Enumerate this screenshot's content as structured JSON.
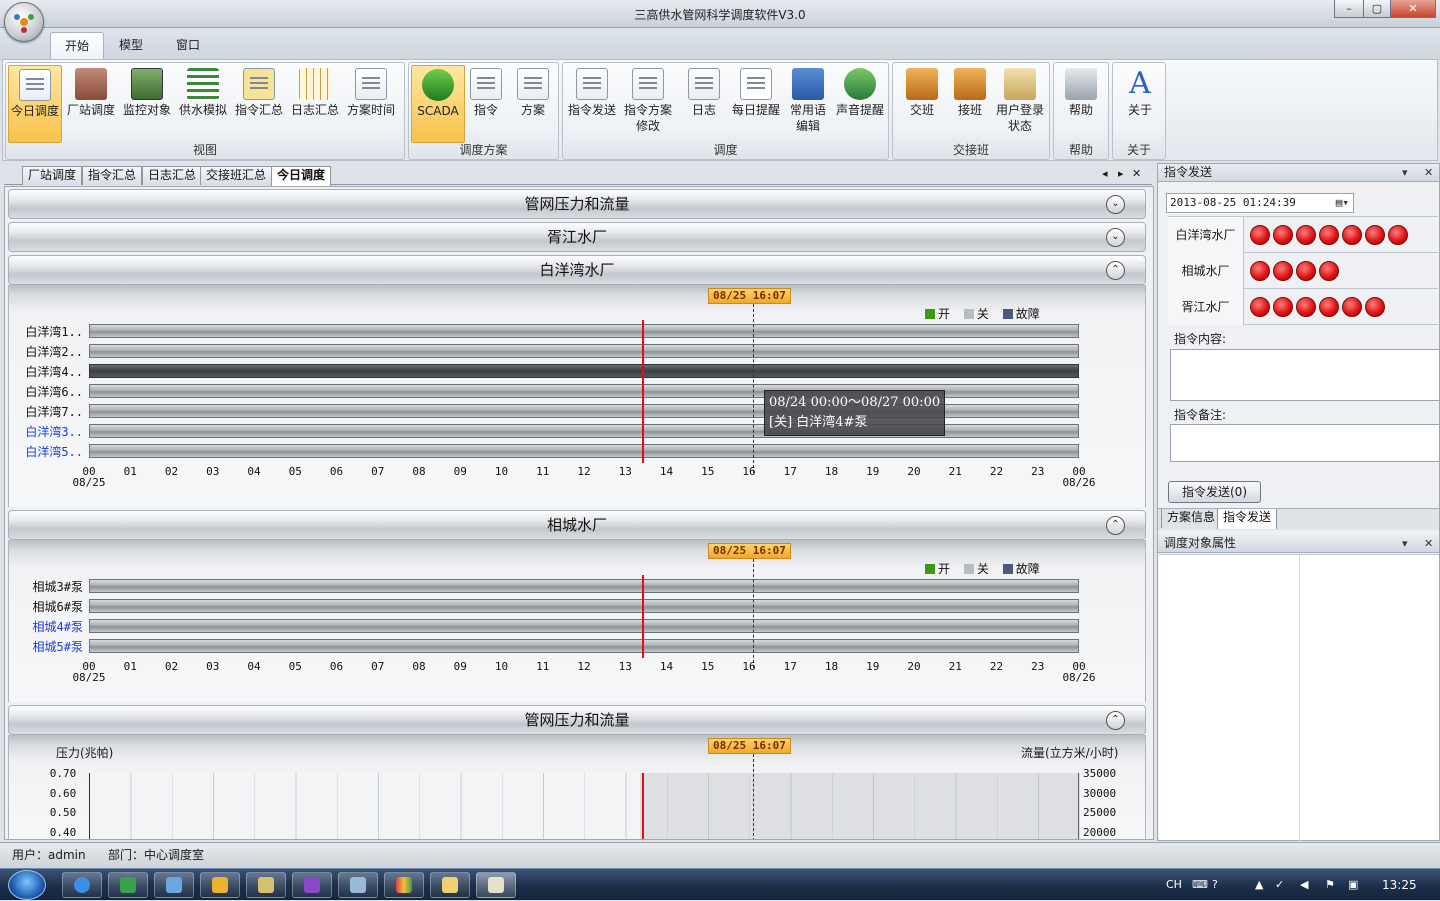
{
  "window": {
    "title": "三高供水管网科学调度软件V3.0",
    "min": "–",
    "max": "▢",
    "close": "✕"
  },
  "ribbon_tabs": [
    "开始",
    "模型",
    "窗口"
  ],
  "groups": {
    "view": {
      "label": "视图",
      "buttons": [
        "今日调度",
        "厂站调度",
        "监控对象",
        "供水模拟",
        "指令汇总",
        "日志汇总",
        "方案时间"
      ]
    },
    "plan": {
      "label": "调度方案",
      "buttons": [
        "SCADA",
        "指令",
        "方案"
      ]
    },
    "dispatch": {
      "label": "调度",
      "buttons": [
        "指令发送",
        "指令方案\n修改",
        "日志",
        "每日提醒",
        "常用语\n编辑",
        "声音提醒"
      ]
    },
    "shift": {
      "label": "交接班",
      "buttons": [
        "交班",
        "接班",
        "用户登录\n状态"
      ]
    },
    "help": {
      "label": "帮助",
      "buttons": [
        "帮助"
      ]
    },
    "about": {
      "label": "关于",
      "buttons": [
        "关于"
      ]
    }
  },
  "doc_tabs": [
    "厂站调度",
    "指令汇总",
    "日志汇总",
    "交接班汇总",
    "今日调度"
  ],
  "doc_nav": {
    "prev": "◂",
    "next": "▸",
    "close": "✕"
  },
  "sections": {
    "s1": {
      "title": "管网压力和流量",
      "state": "collapsed",
      "toggle": "⌄"
    },
    "s2": {
      "title": "胥江水厂",
      "state": "collapsed",
      "toggle": "⌄"
    },
    "s3": {
      "title": "白洋湾水厂",
      "state": "expanded",
      "toggle": "⌃"
    },
    "s4": {
      "title": "相城水厂",
      "state": "expanded",
      "toggle": "⌃"
    },
    "s5": {
      "title": "管网压力和流量",
      "state": "expanded",
      "toggle": "⌃"
    }
  },
  "now_marker": "08/25 16:07",
  "legend": {
    "open": "开",
    "closed": "关",
    "fault": "故障",
    "colors": {
      "open": "#3a9a10",
      "closed": "#b8bbbf",
      "fault": "#4a5a7a"
    }
  },
  "hours": [
    "00",
    "01",
    "02",
    "03",
    "04",
    "05",
    "06",
    "07",
    "08",
    "09",
    "10",
    "11",
    "12",
    "13",
    "14",
    "15",
    "16",
    "17",
    "18",
    "19",
    "20",
    "21",
    "22",
    "23",
    "00"
  ],
  "date_start": "08/25",
  "date_end": "08/26",
  "current_time_hour": 13.4,
  "now_hour": 16.1,
  "baiyangwan": {
    "rows": [
      {
        "label": "白洋湾1..",
        "state": "closed",
        "color": "black"
      },
      {
        "label": "白洋湾2..",
        "state": "closed",
        "color": "black"
      },
      {
        "label": "白洋湾4..",
        "state": "selected",
        "color": "black"
      },
      {
        "label": "白洋湾6..",
        "state": "closed",
        "color": "black"
      },
      {
        "label": "白洋湾7..",
        "state": "closed",
        "color": "black"
      },
      {
        "label": "白洋湾3..",
        "state": "closed",
        "color": "blue"
      },
      {
        "label": "白洋湾5..",
        "state": "closed",
        "color": "blue"
      }
    ]
  },
  "tooltip": {
    "line1": "08/24 00:00～08/27 00:00",
    "line2": "[关] 白洋湾4#泵"
  },
  "xiangcheng": {
    "rows": [
      {
        "label": "相城3#泵",
        "color": "black"
      },
      {
        "label": "相城6#泵",
        "color": "black"
      },
      {
        "label": "相城4#泵",
        "color": "blue"
      },
      {
        "label": "相城5#泵",
        "color": "blue"
      }
    ]
  },
  "pressure": {
    "left_label": "压力(兆帕)",
    "right_label": "流量(立方米/小时)",
    "left_ticks": [
      "0.70",
      "0.60",
      "0.50",
      "0.40"
    ],
    "right_ticks": [
      "35000",
      "30000",
      "25000",
      "20000"
    ]
  },
  "right": {
    "cmd_header": "指令发送",
    "datetime": "2013-08-25 01:24:39",
    "plants": [
      {
        "name": "白洋湾水厂",
        "dots": 7
      },
      {
        "name": "相城水厂",
        "dots": 4
      },
      {
        "name": "胥江水厂",
        "dots": 6
      }
    ],
    "content_label": "指令内容:",
    "note_label": "指令备注:",
    "send_button": "指令发送(0)",
    "tabs": [
      "方案信息",
      "指令发送"
    ],
    "props_header": "调度对象属性"
  },
  "status": {
    "user": "用户：admin",
    "dept": "部门：中心调度室"
  },
  "tray": {
    "lang": "CH",
    "time": "13:25"
  }
}
